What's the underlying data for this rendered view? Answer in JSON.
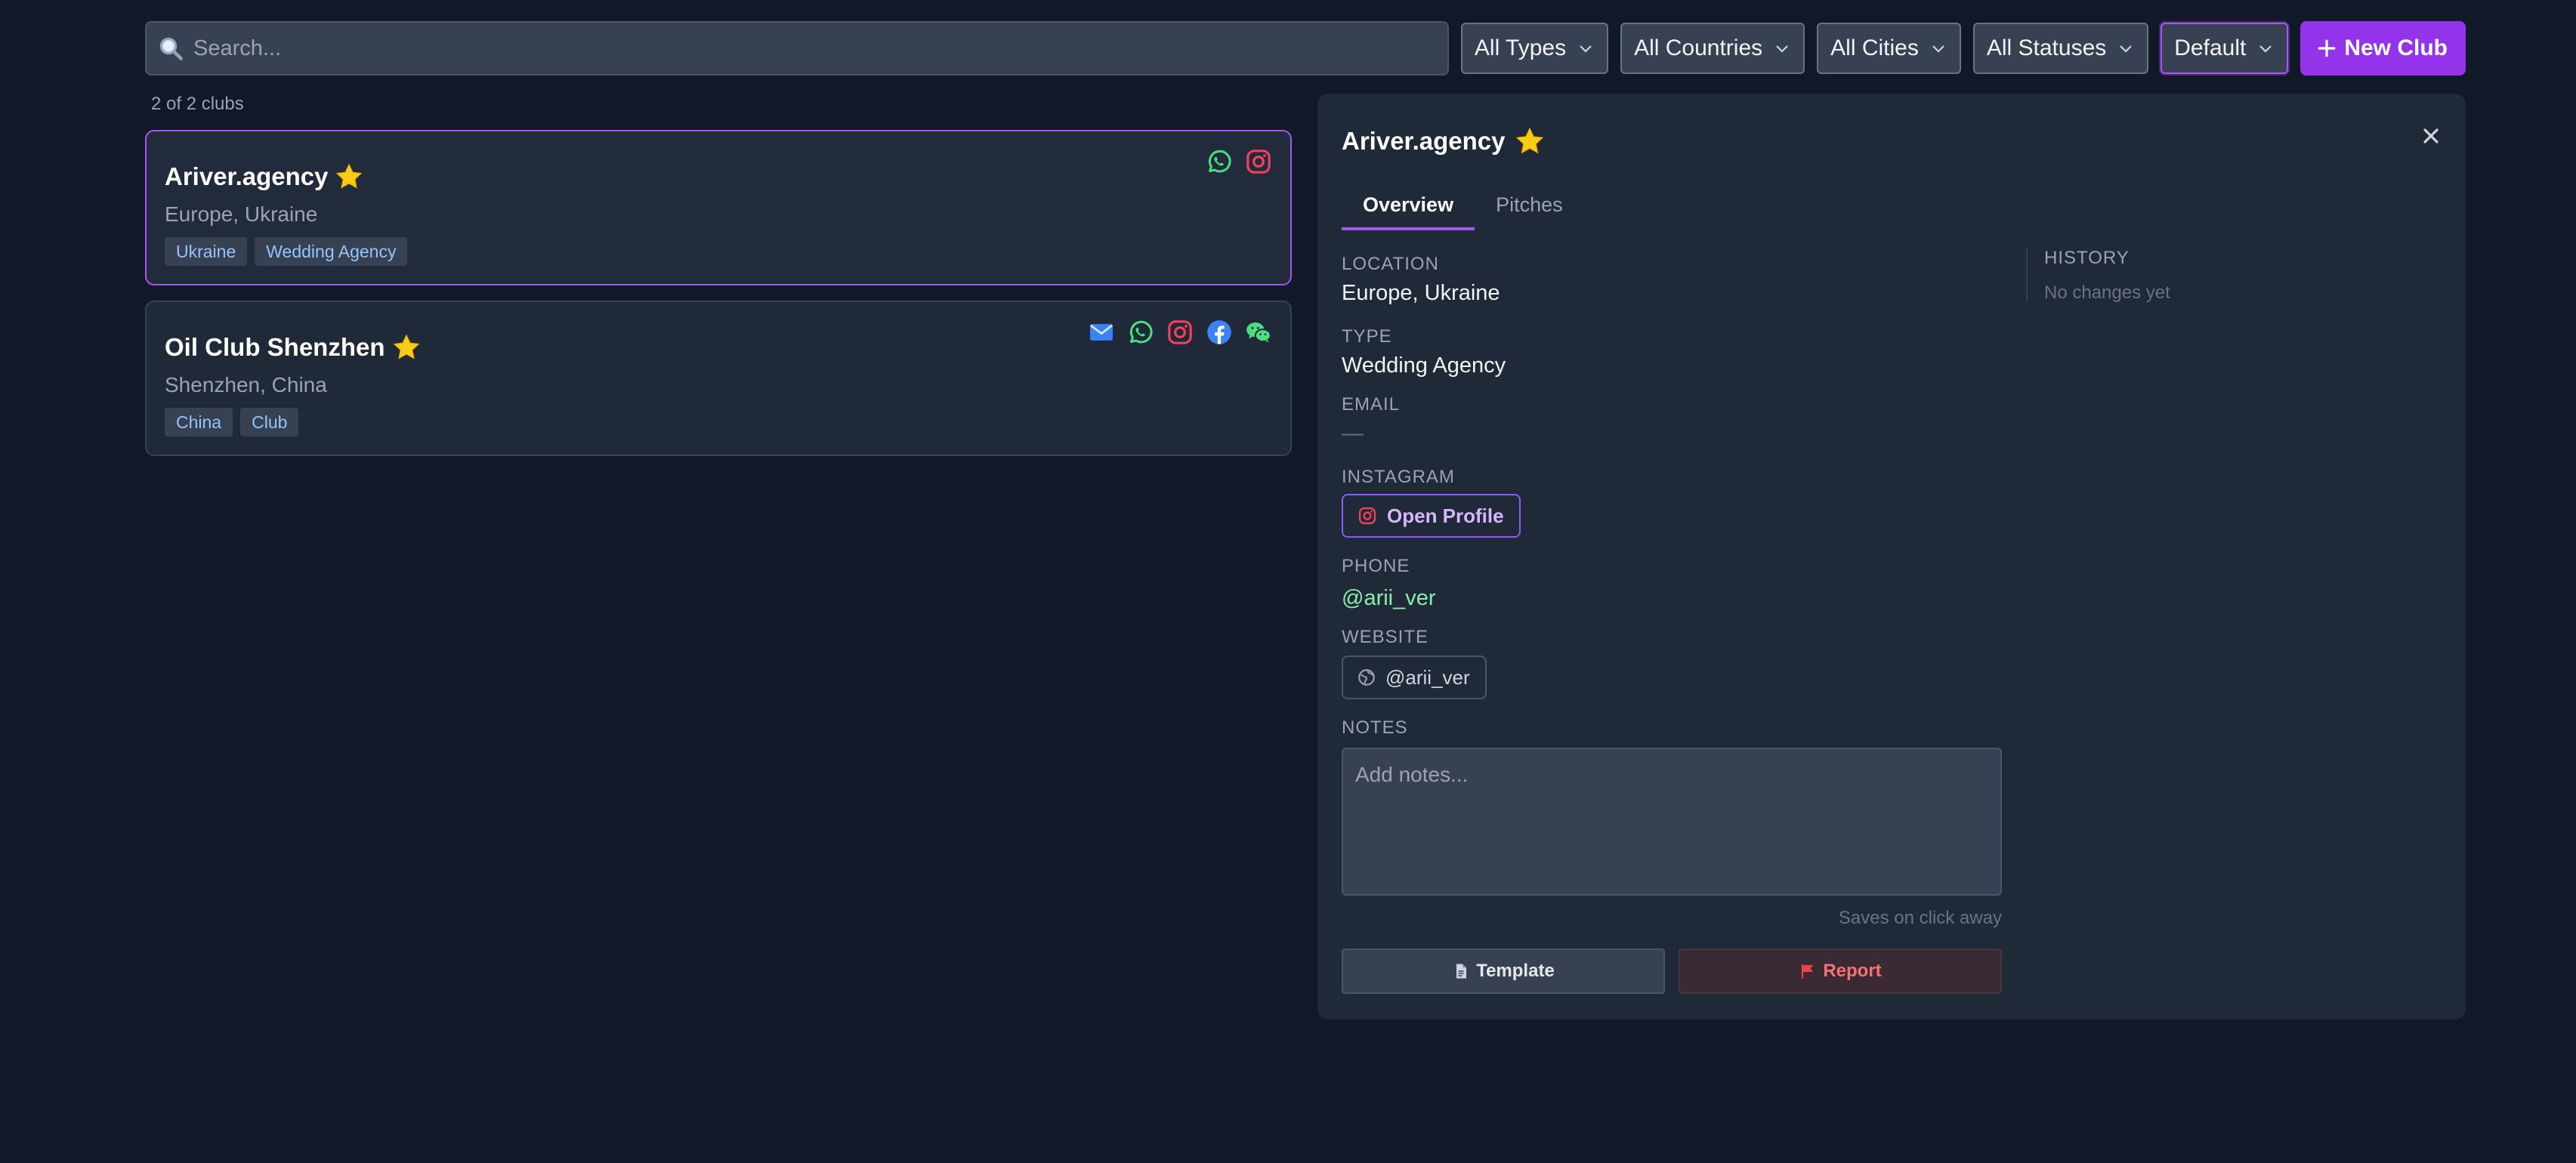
{
  "search": {
    "placeholder": "Search..."
  },
  "filters": {
    "types": "All Types",
    "countries": "All Countries",
    "cities": "All Cities",
    "statuses": "All Statuses",
    "sort": "Default"
  },
  "new_club_label": "New Club",
  "list": {
    "count_text": "2 of 2 clubs",
    "clubs": [
      {
        "name": "Ariver.agency",
        "location": "Europe, Ukraine",
        "tags": [
          "Ukraine",
          "Wedding Agency"
        ],
        "contact_icons": [
          "whatsapp-icon",
          "instagram-icon"
        ],
        "starred": true,
        "selected": true
      },
      {
        "name": "Oil Club Shenzhen",
        "location": "Shenzhen, China",
        "tags": [
          "China",
          "Club"
        ],
        "contact_icons": [
          "email-icon",
          "whatsapp-icon",
          "instagram-icon",
          "facebook-icon",
          "wechat-icon"
        ],
        "starred": true,
        "selected": false
      }
    ]
  },
  "detail": {
    "title": "Ariver.agency",
    "tabs": [
      "Overview",
      "Pitches"
    ],
    "active_tab": "Overview",
    "location_label": "LOCATION",
    "location_value": "Europe, Ukraine",
    "type_label": "TYPE",
    "type_value": "Wedding Agency",
    "email_label": "EMAIL",
    "email_value": "—",
    "instagram_label": "INSTAGRAM",
    "instagram_button": "Open Profile",
    "phone_label": "PHONE",
    "phone_value": "@arii_ver",
    "website_label": "WEBSITE",
    "website_value": "@arii_ver",
    "notes_label": "NOTES",
    "notes_placeholder": "Add notes...",
    "saves_hint": "Saves on click away",
    "template_button": "Template",
    "report_button": "Report",
    "history_label": "HISTORY",
    "history_empty": "No changes yet"
  },
  "colors": {
    "background": "#111827",
    "panel": "#1f2937",
    "accent": "#9333ea",
    "accent_border": "#a855f7",
    "tag_text": "#93c5fd",
    "phone_text": "#86efac",
    "report_text": "#f87171"
  }
}
